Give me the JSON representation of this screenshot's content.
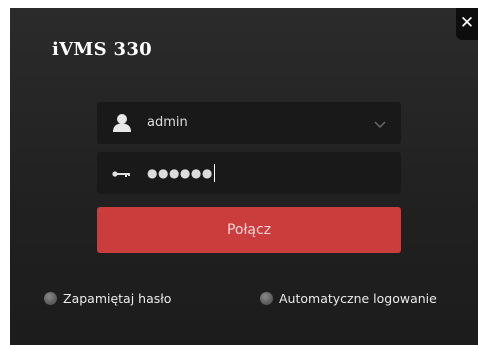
{
  "app": {
    "title": "iVMS 330",
    "close_label": "✕"
  },
  "login": {
    "username": "admin",
    "password_masked": "●●●●●●",
    "connect_label": "Połącz"
  },
  "options": {
    "remember_password": "Zapamiętaj hasło",
    "auto_login": "Automatyczne logowanie"
  },
  "colors": {
    "accent": "#cb3c3d",
    "background": "#232323",
    "field": "#191919"
  },
  "icons": {
    "user": "user-icon",
    "key": "key-icon",
    "dropdown": "chevron-down-icon"
  }
}
